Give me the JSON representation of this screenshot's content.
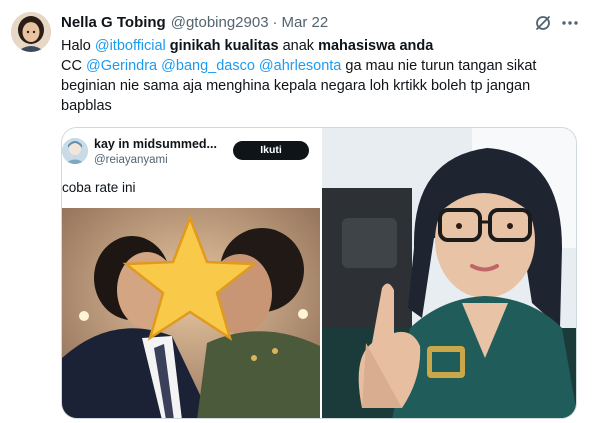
{
  "tweet": {
    "display_name": "Nella G Tobing",
    "handle": "@gtobing2903",
    "separator": "·",
    "date": "Mar 22",
    "lines": [
      [
        {
          "text": "Halo ",
          "style": "plain"
        },
        {
          "text": "@itbofficial",
          "style": "mention"
        },
        {
          "text": " ginikah kualitas",
          "style": "strong"
        },
        {
          "text": " anak ",
          "style": "plain"
        },
        {
          "text": "mahasiswa anda",
          "style": "strong"
        }
      ],
      [
        {
          "text": "CC ",
          "style": "plain"
        },
        {
          "text": "@Gerindra",
          "style": "mention"
        },
        {
          "text": " ",
          "style": "plain"
        },
        {
          "text": "@bang_dasco",
          "style": "mention"
        },
        {
          "text": " ",
          "style": "plain"
        },
        {
          "text": "@ahrlesonta",
          "style": "mention"
        },
        {
          "text": " ga mau nie turun tangan sikat",
          "style": "plain"
        }
      ],
      [
        {
          "text": "beginian nie sama aja menghina kepala negara loh krtikk boleh tp jangan",
          "style": "plain"
        }
      ],
      [
        {
          "text": "bapblas",
          "style": "plain"
        }
      ]
    ],
    "icons": {
      "grok": "grok-icon",
      "more": "more-icon"
    }
  },
  "quoted": {
    "name": "kay in midsummed...",
    "handle": "@reiayanyami",
    "follow_label": "Ikuti",
    "text": "coba rate ini"
  },
  "colors": {
    "link": "#1d9bf0",
    "text": "#0f1419",
    "muted": "#536471",
    "border": "#cfd9de"
  }
}
